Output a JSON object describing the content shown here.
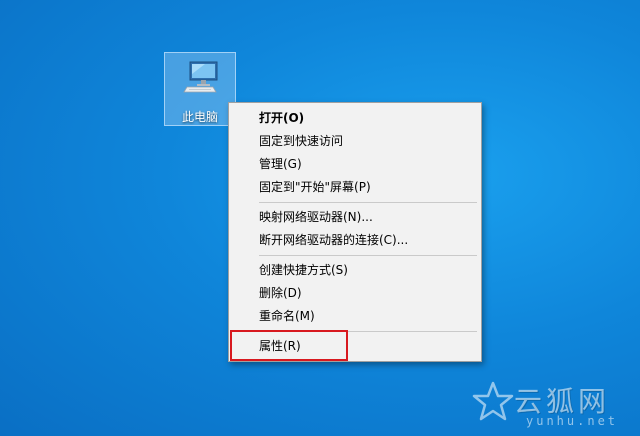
{
  "desktop": {
    "icon": {
      "label": "此电脑",
      "icon_name": "computer-icon"
    }
  },
  "context_menu": {
    "groups": [
      [
        {
          "label": "打开(O)",
          "bold": true
        },
        {
          "label": "固定到快速访问"
        },
        {
          "label": "管理(G)"
        },
        {
          "label": "固定到\"开始\"屏幕(P)"
        }
      ],
      [
        {
          "label": "映射网络驱动器(N)..."
        },
        {
          "label": "断开网络驱动器的连接(C)..."
        }
      ],
      [
        {
          "label": "创建快捷方式(S)"
        },
        {
          "label": "删除(D)"
        },
        {
          "label": "重命名(M)"
        }
      ],
      [
        {
          "label": "属性(R)"
        }
      ]
    ],
    "highlight_color": "#d8191f"
  },
  "watermark": {
    "title": "云狐网",
    "url": "yunhu.net",
    "icon_name": "star-icon"
  }
}
